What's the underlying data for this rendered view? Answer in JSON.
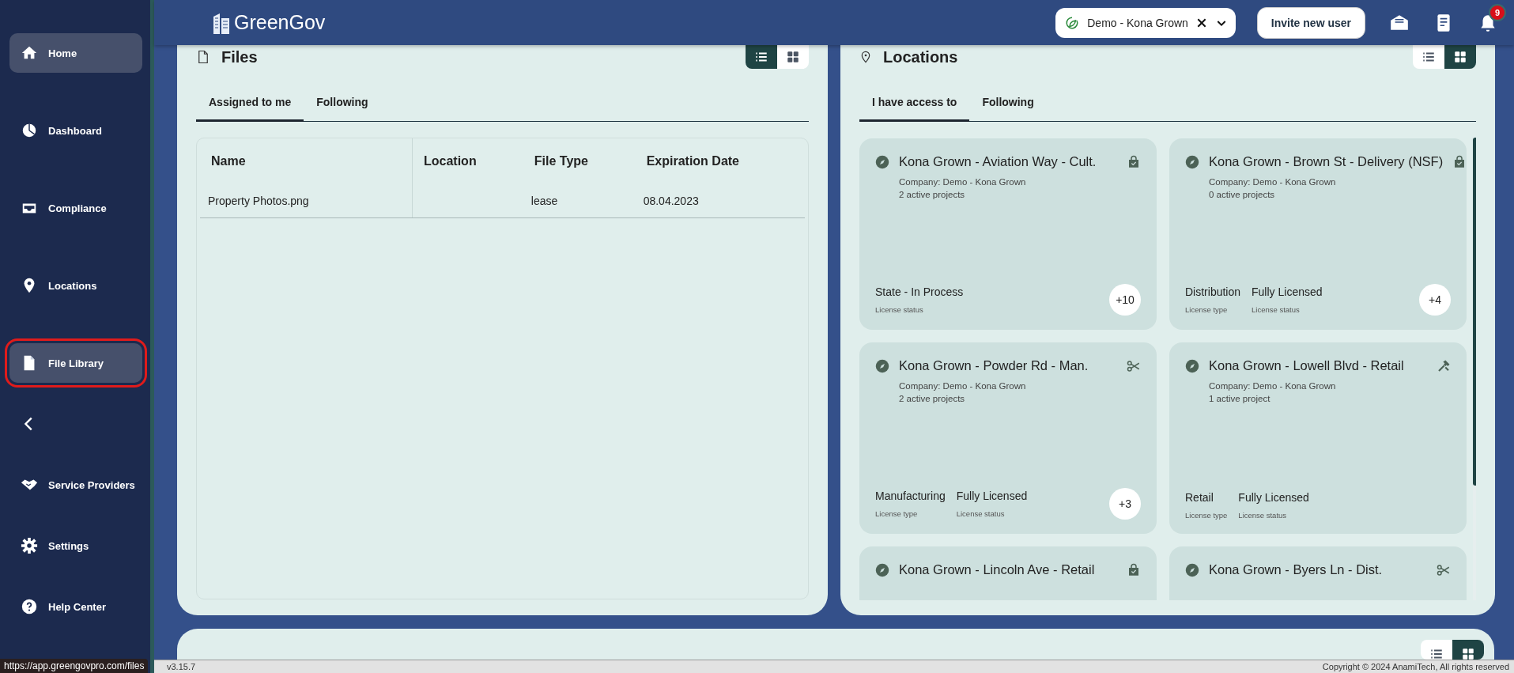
{
  "sidebar": {
    "items": [
      {
        "label": "Home",
        "kind": "home",
        "selected": true,
        "outlined": false
      },
      {
        "label": "Dashboard",
        "kind": "pie",
        "selected": false,
        "outlined": false
      },
      {
        "label": "Compliance",
        "kind": "tray",
        "selected": false,
        "outlined": false
      },
      {
        "label": "Locations",
        "kind": "pin",
        "selected": false,
        "outlined": false
      },
      {
        "label": "File Library",
        "kind": "file",
        "selected": true,
        "outlined": true
      },
      {
        "kind": "back",
        "selected": false,
        "outlined": false
      },
      {
        "label": "Service Providers",
        "kind": "handshake",
        "selected": false,
        "outlined": false
      },
      {
        "label": "Settings",
        "kind": "gear",
        "selected": false,
        "outlined": false
      },
      {
        "label": "Help Center",
        "kind": "help",
        "selected": false,
        "outlined": false
      }
    ]
  },
  "topbar": {
    "logo": "GreenGov",
    "company": "Demo - Kona Grown",
    "invite_button": "Invite new user",
    "notification_count": "9"
  },
  "files": {
    "title": "Files",
    "view_toggle": [
      {
        "kind": "list",
        "selected": true
      },
      {
        "kind": "grid",
        "selected": false
      }
    ],
    "tabs": [
      {
        "label": "Assigned to me",
        "selected": true
      },
      {
        "label": "Following",
        "selected": false
      }
    ],
    "table": {
      "columns": [
        "Name",
        "Location",
        "File Type",
        "Expiration Date"
      ],
      "rows": [
        [
          "Property Photos.png",
          "",
          "lease",
          "08.04.2023"
        ]
      ]
    }
  },
  "locations": {
    "title": "Locations",
    "view_toggle": [
      {
        "kind": "list",
        "selected": false
      },
      {
        "kind": "grid",
        "selected": true
      }
    ],
    "tabs": [
      {
        "label": "I have access to",
        "selected": true
      },
      {
        "label": "Following",
        "selected": false
      }
    ],
    "cards": [
      {
        "title": "Kona Grown - Aviation Way - Cult.",
        "kind": "bag",
        "company": "Company: Demo - Kona Grown",
        "projects": "2 active projects",
        "fields": [
          {
            "value": "State - In Process",
            "label": "License status"
          }
        ],
        "more": "+10"
      },
      {
        "title": "Kona Grown - Brown St - Delivery (NSF)",
        "kind": "bag",
        "company": "Company: Demo - Kona Grown",
        "projects": "0 active projects",
        "fields": [
          {
            "value": "Distribution",
            "label": "License type"
          },
          {
            "value": "Fully Licensed",
            "label": "License status"
          }
        ],
        "more": "+4"
      },
      {
        "title": "Kona Grown - Powder Rd - Man.",
        "kind": "scissors",
        "company": "Company: Demo - Kona Grown",
        "projects": "2 active projects",
        "fields": [
          {
            "value": "Manufacturing",
            "label": "License type"
          },
          {
            "value": "Fully Licensed",
            "label": "License status"
          }
        ],
        "more": "+3"
      },
      {
        "title": "Kona Grown - Lowell Blvd - Retail",
        "kind": "tools",
        "company": "Company: Demo - Kona Grown",
        "projects": "1 active project",
        "fields": [
          {
            "value": "Retail",
            "label": "License type"
          },
          {
            "value": "Fully Licensed",
            "label": "License status"
          }
        ]
      },
      {
        "title": "Kona Grown - Lincoln Ave - Retail",
        "kind": "bag"
      },
      {
        "title": "Kona Grown - Byers Ln - Dist.",
        "kind": "scissors"
      }
    ]
  },
  "tasks": {
    "view_toggle": [
      {
        "kind": "list",
        "selected": false
      },
      {
        "kind": "grid",
        "selected": true
      }
    ]
  },
  "status_bar": {
    "url": "https://app.greengovpro.com/files",
    "version": "v3.15.7",
    "copyright": "Copyright © 2024 AnamiTech, All rights reserved"
  }
}
